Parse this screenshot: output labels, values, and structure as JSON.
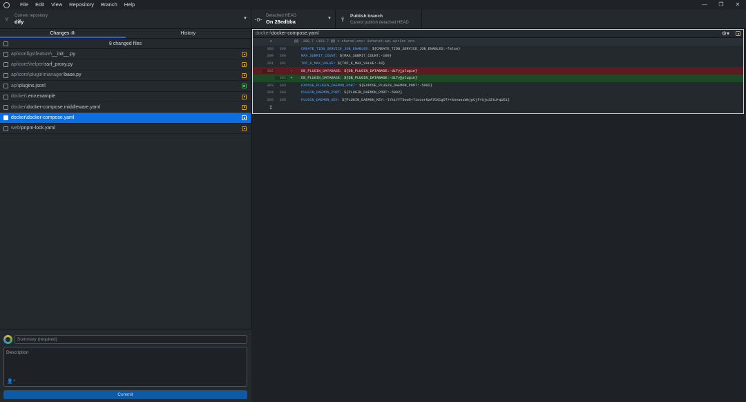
{
  "menu": [
    "File",
    "Edit",
    "View",
    "Repository",
    "Branch",
    "Help"
  ],
  "window": {
    "minimize": "—",
    "maximize": "❐",
    "close": "✕"
  },
  "toolbar": {
    "repo": {
      "label": "Current repository",
      "value": "dify"
    },
    "branch": {
      "label": "Detached HEAD",
      "value": "On 28edbba"
    },
    "publish": {
      "label": "Publish branch",
      "sublabel": "Cannot publish detached HEAD"
    }
  },
  "tabs": {
    "changes": "Changes",
    "changes_count": "8",
    "history": "History"
  },
  "changed_files_label": "8 changed files",
  "files": [
    {
      "dir": "api\\configs\\feature\\",
      "name": "__init__.py",
      "status": "modified"
    },
    {
      "dir": "api\\core\\helper\\",
      "name": "ssrf_proxy.py",
      "status": "modified"
    },
    {
      "dir": "api\\core\\plugin\\manager\\",
      "name": "base.py",
      "status": "modified"
    },
    {
      "dir": "api\\",
      "name": "plugins.jsonl",
      "status": "added"
    },
    {
      "dir": "docker\\",
      "name": ".env.example",
      "status": "modified"
    },
    {
      "dir": "docker\\",
      "name": "docker-compose.middleware.yaml",
      "status": "modified"
    },
    {
      "dir": "docker\\",
      "name": "docker-compose.yaml",
      "status": "modified",
      "selected": true
    },
    {
      "dir": "web\\",
      "name": "pnpm-lock.yaml",
      "status": "modified"
    }
  ],
  "commit": {
    "summary_placeholder": "Summary (required)",
    "description_placeholder": "Description",
    "button": "Commit"
  },
  "diff": {
    "file_dir": "docker\\",
    "file_name": "docker-compose.yaml",
    "hunk_header": "@@ -389,7 +389,7 @@ x-shared-env: &shared-api-worker-env",
    "lines": [
      {
        "type": "context",
        "old": "389",
        "new": "389",
        "key": "CREATE_TIDB_SERVICE_JOB_ENABLED:",
        "val": " ${CREATE_TIDB_SERVICE_JOB_ENABLED:-false}"
      },
      {
        "type": "context",
        "old": "390",
        "new": "390",
        "key": "MAX_SUBMIT_COUNT:",
        "val": " ${MAX_SUBMIT_COUNT:-100}"
      },
      {
        "type": "context",
        "old": "391",
        "new": "391",
        "key": "TOP_K_MAX_VALUE:",
        "val": " ${TOP_K_MAX_VALUE:-10}"
      },
      {
        "type": "del",
        "old": "392",
        "new": "",
        "sign": "-",
        "key": "DB_PLUGIN_DATABASE:",
        "pre": " ${DB_PLUGIN_DATABASE:-dify",
        "hl": "_",
        "post": "plugin}"
      },
      {
        "type": "add",
        "old": "",
        "new": "392",
        "sign": "+",
        "key": "DB_PLUGIN_DATABASE:",
        "pre": " ${DB_PLUGIN_DATABASE:-dify",
        "hl": "-",
        "post": "plugin}"
      },
      {
        "type": "context",
        "old": "393",
        "new": "393",
        "key": "EXPOSE_PLUGIN_DAEMON_PORT:",
        "val": " ${EXPOSE_PLUGIN_DAEMON_PORT:-5002}"
      },
      {
        "type": "context",
        "old": "394",
        "new": "394",
        "key": "PLUGIN_DAEMON_PORT:",
        "val": " ${PLUGIN_DAEMON_PORT:-5002}"
      },
      {
        "type": "context",
        "old": "395",
        "new": "395",
        "key": "PLUGIN_DAEMON_KEY:",
        "val": " ${PLUGIN_DAEMON_KEY:-lYkiYYT6owG+71oLerGzA7GXCgOT++6ovaezWAjpCjf+Sjc3ZtU+qUEi}"
      }
    ]
  },
  "colors": {
    "accent": "#0b6ee1",
    "modified": "#d29b22",
    "added": "#3fb34f",
    "del_bg": "#5c1c1f",
    "add_bg": "#1c4a27"
  },
  "icons": {
    "logo": "github-logo-icon",
    "repo": "repo-fork-icon",
    "branch": "git-commit-icon",
    "publish": "upload-icon",
    "settings": "gear-icon",
    "coauthor": "add-person-icon",
    "expand": "expand-up-icon"
  }
}
